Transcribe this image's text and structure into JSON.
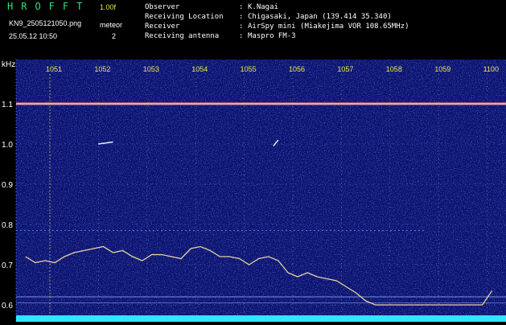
{
  "app": {
    "title": "HROFFT",
    "version": "1.00f",
    "filename": "KN9_2505121050.png",
    "mode": "meteor",
    "timestamp": "25.05.12 10:50",
    "count": "2"
  },
  "meta": [
    {
      "label": "Observer",
      "value": "K.Nagai"
    },
    {
      "label": "Receiving Location",
      "value": "Chigasaki, Japan (139.414 35.340)"
    },
    {
      "label": "Receiver",
      "value": "AirSpy mini (Miakejima VOR 108.65MHz)"
    },
    {
      "label": "Receiving antenna",
      "value": "Maspro FM-3"
    }
  ],
  "separator": ":",
  "colors": {
    "background": "#0b1270",
    "tick_text": "#e7e64a",
    "axis_text": "#ffffff",
    "grid": "#b8b84a",
    "title_green": "#34e07a",
    "carrier": "#d8d8d8",
    "noise_band": "#2ee6ff"
  },
  "chart_data": {
    "type": "heatmap",
    "y_unit": "kHz",
    "x_ticks": [
      "1051",
      "1052",
      "1053",
      "1054",
      "1055",
      "1056",
      "1057",
      "1058",
      "1059",
      "1100"
    ],
    "y_ticks": [
      "1.1",
      "1.0",
      "0.9",
      "0.8",
      "0.7",
      "0.6"
    ],
    "y_range": [
      0.58,
      1.15
    ],
    "carrier_khz": 1.1,
    "drift_trace": {
      "x": [
        1050.5,
        1050.7,
        1050.9,
        1051.1,
        1051.3,
        1051.5,
        1051.7,
        1051.9,
        1052.1,
        1052.3,
        1052.5,
        1052.7,
        1052.9,
        1053.1,
        1053.3,
        1053.5,
        1053.7,
        1053.9,
        1054.1,
        1054.3,
        1054.5,
        1054.7,
        1054.9,
        1055.1,
        1055.3,
        1055.5,
        1055.7,
        1055.9,
        1056.1,
        1056.3,
        1056.5,
        1056.7,
        1056.9,
        1057.1,
        1057.3,
        1057.5,
        1057.7,
        1057.9,
        1058.1,
        1058.3,
        1058.5,
        1058.7,
        1058.9,
        1059.1,
        1059.3,
        1059.5,
        1059.7,
        1059.9,
        1100.1
      ],
      "y": [
        0.72,
        0.705,
        0.71,
        0.705,
        0.72,
        0.73,
        0.735,
        0.74,
        0.745,
        0.73,
        0.735,
        0.72,
        0.71,
        0.725,
        0.725,
        0.72,
        0.715,
        0.74,
        0.745,
        0.735,
        0.72,
        0.72,
        0.715,
        0.7,
        0.715,
        0.72,
        0.71,
        0.68,
        0.67,
        0.68,
        0.67,
        0.665,
        0.66,
        0.645,
        0.63,
        0.61,
        0.6,
        0.6,
        0.6,
        0.6,
        0.6,
        0.6,
        0.6,
        0.6,
        0.6,
        0.6,
        0.6,
        0.6,
        0.635
      ]
    },
    "meteor_echoes": [
      {
        "x": [
          1052.0,
          1052.3
        ],
        "y": [
          1.0,
          1.005
        ]
      },
      {
        "x": [
          1055.6,
          1055.7
        ],
        "y": [
          0.995,
          1.01
        ]
      }
    ]
  }
}
